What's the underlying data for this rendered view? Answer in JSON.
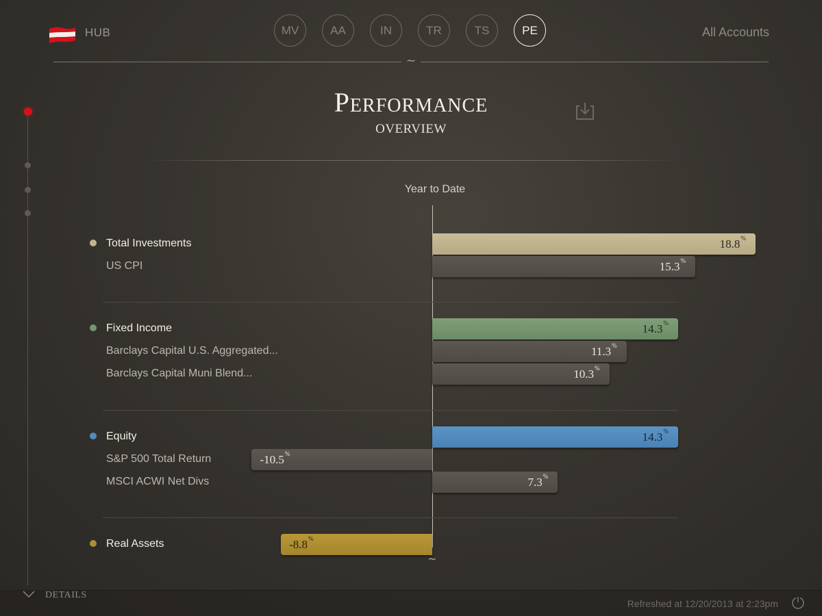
{
  "header": {
    "hub_label": "HUB",
    "tabs": [
      {
        "label": "MV"
      },
      {
        "label": "AA"
      },
      {
        "label": "IN"
      },
      {
        "label": "TR"
      },
      {
        "label": "TS"
      },
      {
        "label": "PE"
      }
    ],
    "active_tab": "PE",
    "accounts_label": "All Accounts",
    "divider_glyph": "~"
  },
  "page": {
    "title": "Performance",
    "subtitle": "OVERVIEW"
  },
  "chart": {
    "period_label": "Year to Date",
    "axis_end_glyph": "~",
    "percent_suffix": "%"
  },
  "chart_data": {
    "type": "bar",
    "orientation": "horizontal",
    "unit": "%",
    "groups": [
      {
        "name": "Total Investments",
        "color": "#c0b48f",
        "rows": [
          {
            "label": "Total Investments",
            "value": 18.8,
            "display": "18.8",
            "primary": true
          },
          {
            "label": "US CPI",
            "value": 15.3,
            "display": "15.3",
            "primary": false
          }
        ]
      },
      {
        "name": "Fixed Income",
        "color": "#759670",
        "rows": [
          {
            "label": "Fixed Income",
            "value": 14.3,
            "display": "14.3",
            "primary": true
          },
          {
            "label": "Barclays Capital U.S. Aggregated...",
            "value": 11.3,
            "display": "11.3",
            "primary": false
          },
          {
            "label": "Barclays Capital Muni Blend...",
            "value": 10.3,
            "display": "10.3",
            "primary": false
          }
        ]
      },
      {
        "name": "Equity",
        "color": "#528bbc",
        "rows": [
          {
            "label": "Equity",
            "value": 14.3,
            "display": "14.3",
            "primary": true
          },
          {
            "label": "S&P 500 Total Return",
            "value": -10.5,
            "display": "-10.5",
            "primary": false
          },
          {
            "label": "MSCI ACWI Net Divs",
            "value": 7.3,
            "display": "7.3",
            "primary": false
          }
        ]
      },
      {
        "name": "Real Assets",
        "color": "#af8f33",
        "rows": [
          {
            "label": "Real Assets",
            "value": -8.8,
            "display": "-8.8",
            "primary": true
          }
        ]
      }
    ]
  },
  "footer": {
    "details_label": "DETAILS",
    "refreshed_text": "Refreshed at 12/20/2013 at 2:23pm"
  },
  "colors": {
    "timeline_active": "#d4121a",
    "background": "#37342f"
  }
}
